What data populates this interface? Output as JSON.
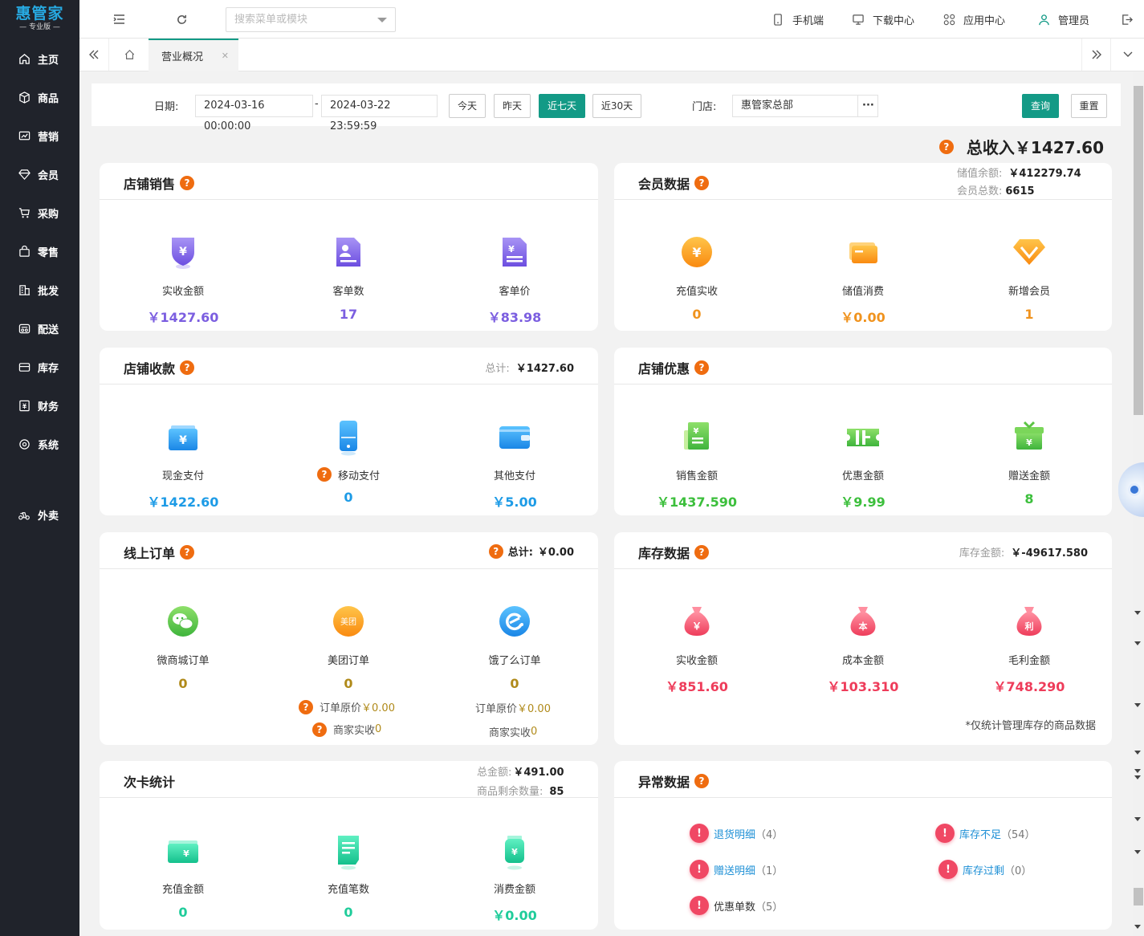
{
  "brand": {
    "name": "惠管家",
    "edition": "— 专业版 —"
  },
  "sidebar": {
    "items": [
      {
        "label": "主页",
        "icon": "home-icon"
      },
      {
        "label": "商品",
        "icon": "box-icon"
      },
      {
        "label": "营销",
        "icon": "chart-icon"
      },
      {
        "label": "会员",
        "icon": "diamond-icon"
      },
      {
        "label": "采购",
        "icon": "cart-icon"
      },
      {
        "label": "零售",
        "icon": "bag-icon"
      },
      {
        "label": "批发",
        "icon": "building-icon"
      },
      {
        "label": "配送",
        "icon": "truck-icon"
      },
      {
        "label": "库存",
        "icon": "inventory-icon"
      },
      {
        "label": "财务",
        "icon": "finance-icon"
      },
      {
        "label": "系统",
        "icon": "settings-icon"
      },
      {
        "label": "外卖",
        "icon": "delivery-icon"
      }
    ]
  },
  "topbar": {
    "search_placeholder": "搜索菜单或模块",
    "mobile": "手机端",
    "download": "下载中心",
    "apps": "应用中心",
    "user": "管理员"
  },
  "tabs": {
    "active": "营业概况"
  },
  "filter": {
    "date_label": "日期:",
    "start": "2024-03-16 00:00:00",
    "sep": "-",
    "end": "2024-03-22 23:59:59",
    "today": "今天",
    "yesterday": "昨天",
    "last7": "近七天",
    "last30": "近30天",
    "store_label": "门店:",
    "store": "惠管家总部",
    "more": "···",
    "query": "查询",
    "reset": "重置"
  },
  "total": {
    "label": "总收入",
    "value": "￥1427.60"
  },
  "store_sales": {
    "title": "店铺销售",
    "items": [
      {
        "label": "实收金额",
        "value": "￥1427.60",
        "color": "#7b5ee0"
      },
      {
        "label": "客单数",
        "value": "17",
        "color": "#7b5ee0"
      },
      {
        "label": "客单价",
        "value": "￥83.98",
        "color": "#7b5ee0"
      }
    ]
  },
  "member": {
    "title": "会员数据",
    "balance_label": "储值余额:",
    "balance": "￥412279.74",
    "count_label": "会员总数:",
    "count": "6615",
    "items": [
      {
        "label": "充值实收",
        "value": "0",
        "color": "#f0931e"
      },
      {
        "label": "储值消费",
        "value": "￥0.00",
        "color": "#f0931e"
      },
      {
        "label": "新增会员",
        "value": "1",
        "color": "#f0931e"
      }
    ]
  },
  "payment": {
    "title": "店铺收款",
    "total_label": "总计:",
    "total": "￥1427.60",
    "items": [
      {
        "label": "现金支付",
        "value": "￥1422.60",
        "color": "#1d9be6"
      },
      {
        "label": "移动支付",
        "value": "0",
        "color": "#1d9be6"
      },
      {
        "label": "其他支付",
        "value": "￥5.00",
        "color": "#1d9be6"
      }
    ]
  },
  "discount": {
    "title": "店铺优惠",
    "items": [
      {
        "label": "销售金额",
        "value": "￥1437.590",
        "color": "#3cbf3c"
      },
      {
        "label": "优惠金额",
        "value": "￥9.99",
        "color": "#3cbf3c"
      },
      {
        "label": "赠送金额",
        "value": "8",
        "color": "#3cbf3c"
      }
    ]
  },
  "online": {
    "title": "线上订单",
    "total_label": "总计:",
    "total": "￥0.00",
    "items": [
      {
        "label": "微商城订单",
        "value": "0",
        "color": "#b08a1a"
      },
      {
        "label": "美团订单",
        "value": "0",
        "color": "#b08a1a"
      },
      {
        "label": "饿了么订单",
        "value": "0",
        "color": "#b08a1a"
      }
    ],
    "meituan_orig_label": "订单原价",
    "meituan_orig": "￥0.00",
    "meituan_merchant_label": "商家实收",
    "meituan_merchant": "0",
    "eleme_orig_label": "订单原价",
    "eleme_orig": "￥0.00",
    "eleme_merchant_label": "商家实收",
    "eleme_merchant": "0",
    "meituan_icon_text": "美团"
  },
  "stock": {
    "title": "库存数据",
    "amount_label": "库存金额:",
    "amount": "￥-49617.580",
    "note": "*仅统计管理库存的商品数据",
    "items": [
      {
        "label": "实收金额",
        "value": "￥851.60",
        "color": "#ee3c5a",
        "glyph": "￥"
      },
      {
        "label": "成本金额",
        "value": "￥103.310",
        "color": "#ee3c5a",
        "glyph": "本"
      },
      {
        "label": "毛利金额",
        "value": "￥748.290",
        "color": "#ee3c5a",
        "glyph": "利"
      }
    ]
  },
  "card_stat": {
    "title": "次卡统计",
    "total_label": "总金额:",
    "total": "￥491.00",
    "remain_label": "商品剩余数量:",
    "remain": "85",
    "items": [
      {
        "label": "充值金额",
        "value": "0",
        "color": "#1fcc9a"
      },
      {
        "label": "充值笔数",
        "value": "0",
        "color": "#1fcc9a"
      },
      {
        "label": "消费金额",
        "value": "￥0.00",
        "color": "#1fcc9a"
      }
    ]
  },
  "anomaly": {
    "title": "异常数据",
    "items": [
      {
        "label": "退货明细",
        "count": "（4）"
      },
      {
        "label": "库存不足",
        "count": "（54）"
      },
      {
        "label": "赠送明细",
        "count": "（1）"
      },
      {
        "label": "库存过剩",
        "count": "（0）"
      },
      {
        "label": "优惠单数",
        "count": "（5）"
      }
    ]
  },
  "help_glyph": "?",
  "warn_glyph": "!"
}
